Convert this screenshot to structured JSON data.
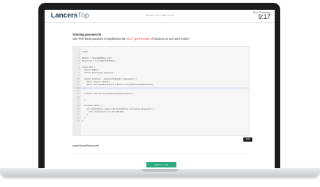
{
  "header": {
    "logo_strong": "Lancers",
    "logo_light": "Top",
    "section_progress": "Section 1 of 3: Step 2 of 6",
    "time_label": "Time Remaining",
    "time_value": "9:17"
  },
  "question": {
    "title": "Storing passwords",
    "desc_before": "Use PHP best practices to implement the ",
    "desc_keyword": "encryptPassword",
    "desc_after": " function on our User model."
  },
  "editor": {
    "language": "PHP",
    "highlighted_line": 13,
    "lines": [
      {
        "n": "1",
        "t": "<?php"
      },
      {
        "n": "2",
        "t": ""
      },
      {
        "n": "3",
        "t": "$email = \"diana@dfbuys.com\";"
      },
      {
        "n": "4",
        "t": "$password = trim(fgets(STDIN));"
      },
      {
        "n": "5",
        "t": ""
      },
      {
        "n": "6",
        "t": "class User {"
      },
      {
        "n": "7",
        "t": "  public $email;"
      },
      {
        "n": "8",
        "t": "  public $encrypted_password;"
      },
      {
        "n": "9",
        "t": ""
      },
      {
        "n": "10",
        "t": "  public function __construct($email, $password) {"
      },
      {
        "n": "11",
        "t": "    $this->email = $email;"
      },
      {
        "n": "12",
        "t": "    $this->encrypted_password = $this->encryptPassword($password);"
      },
      {
        "n": "13",
        "t": "  }"
      },
      {
        "n": "14",
        "t": ""
      },
      {
        "n": "15",
        "t": "  private function encryptPassword($password) {"
      },
      {
        "n": "16",
        "t": ""
      },
      {
        "n": "17",
        "t": "  }"
      },
      {
        "n": "18",
        "t": ""
      },
      {
        "n": "19",
        "t": "  function save() {"
      },
      {
        "n": "20",
        "t": "    if (count($this->email) && count($this->encrypted_password)) {"
      },
      {
        "n": "21",
        "t": "      echo \"Saving user to db\".PHP_EOL;"
      },
      {
        "n": "22",
        "t": "    }"
      },
      {
        "n": "23",
        "t": "  }"
      },
      {
        "n": "24",
        "t": "}"
      }
    ]
  },
  "answer_text": "superSecretPassword!",
  "submit_label": "NEXT ▸ 6/6",
  "colors": {
    "accent": "#2ea97d",
    "keyword": "#e03b3b",
    "logo": "#1e3a4d",
    "laptop_bezel": "#1b1c1e"
  }
}
